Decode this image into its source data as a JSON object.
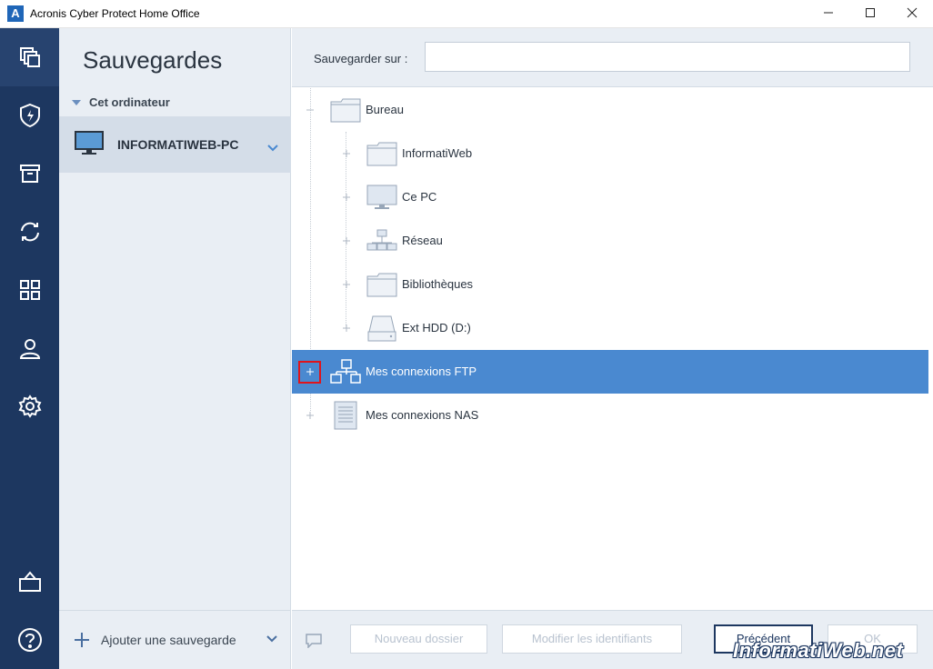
{
  "window": {
    "title": "Acronis Cyber Protect Home Office",
    "app_icon_letter": "A"
  },
  "rail": {
    "items": [
      "backup-icon",
      "shield-icon",
      "archive-icon",
      "sync-icon",
      "tools-icon",
      "account-icon",
      "settings-icon",
      "store-icon",
      "help-icon"
    ],
    "active": "backup-icon"
  },
  "panel": {
    "title": "Sauvegardes",
    "group_label": "Cet ordinateur",
    "computer_name": "INFORMATIWEB-PC",
    "add_backup_label": "Ajouter une sauvegarde"
  },
  "destination": {
    "label": "Sauvegarder sur :",
    "value": ""
  },
  "tree": {
    "root": "Bureau",
    "children": [
      "InformatiWeb",
      "Ce PC",
      "Réseau",
      "Bibliothèques",
      "Ext HDD (D:)"
    ],
    "ftp": "Mes connexions FTP",
    "nas": "Mes connexions NAS",
    "selected": "Mes connexions FTP"
  },
  "footer": {
    "new_folder": "Nouveau dossier",
    "edit_credentials": "Modifier les identifiants",
    "previous": "Précédent",
    "ok": "OK"
  },
  "watermark": "InformatiWeb.net",
  "colors": {
    "rail_bg": "#1d3760",
    "panel_bg": "#e9eef4",
    "selection": "#4a89d0",
    "highlight_box": "#e0141b"
  }
}
